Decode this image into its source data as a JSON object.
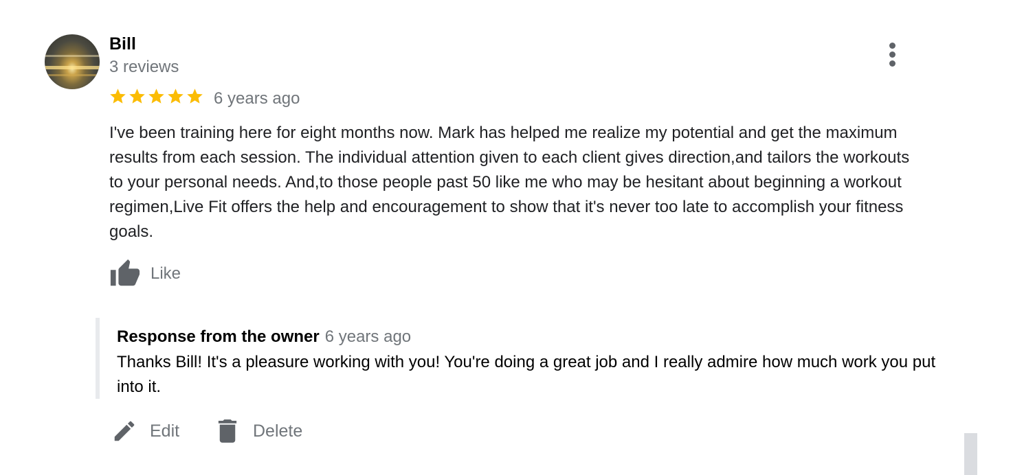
{
  "review": {
    "reviewer_name": "Bill",
    "review_count": "3 reviews",
    "rating": 5,
    "rating_max": 5,
    "date": "6 years ago",
    "text": "I've been training here for eight months now. Mark has helped me realize my potential and get the maximum results from each session. The individual attention given to each client gives direction,and tailors the workouts to your personal needs. And,to those people past 50 like me who may be hesitant about beginning a workout regimen,Live Fit offers the help and encouragement to show that it's never too late to accomplish your fitness goals.",
    "like_label": "Like"
  },
  "owner_response": {
    "title": "Response from the owner",
    "date": "6 years ago",
    "text": "Thanks Bill! It's a pleasure working with you! You're doing a great job and I really admire how much work you put into it."
  },
  "actions": {
    "edit_label": "Edit",
    "delete_label": "Delete"
  },
  "icons": {
    "avatar": "reviewer-photo",
    "menu": "more-vert-icon",
    "star": "star-icon",
    "like": "thumb-up-icon",
    "edit": "pencil-icon",
    "delete": "trash-icon"
  },
  "colors": {
    "star": "#fbbc04",
    "secondary_text": "#70757a",
    "icon": "#5f6368",
    "response_border": "#e8eaed"
  }
}
